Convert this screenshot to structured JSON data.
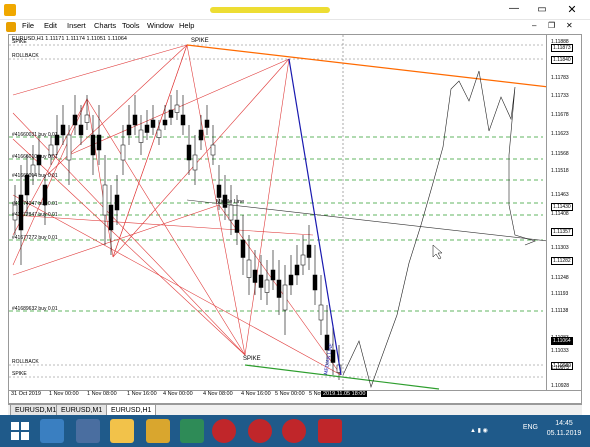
{
  "menu": [
    "File",
    "Edit",
    "Insert",
    "Charts",
    "Tools",
    "Window",
    "Help"
  ],
  "chart": {
    "header": "EURUSD,H1  1.11171 1.11174 1.11051 1.11064",
    "y_labels": [
      "1.11888",
      "1.11873",
      "1.11840",
      "1.11783",
      "1.11733",
      "1.11678",
      "1.11623",
      "1.11568",
      "1.11518",
      "1.11463",
      "1.11430",
      "1.11408",
      "1.11357",
      "1.11303",
      "1.11282",
      "1.11248",
      "1.11193",
      "1.11138",
      "1.11083",
      "1.11064",
      "1.11033",
      "1.10989",
      "1.10973",
      "1.10928"
    ],
    "x_labels": [
      "31 Oct 2019",
      "1 Nov 00:00",
      "1 Nov 08:00",
      "1 Nov 16:00",
      "4 Nov 00:00",
      "4 Nov 08:00",
      "4 Nov 16:00",
      "5 Nov 00:00",
      "5 Nov 08:00",
      "2019.11.05 18:00"
    ],
    "hlines": [
      "SPIKE",
      "ROLLBACK",
      "#41660031 buy 0.01",
      "#41666010 buy 0.01",
      "#41669014 buy 0.01",
      "#41674047 buy 0.01",
      "#41672847 buy 0.01",
      "#41677272 buy 0.01",
      "#41689632 buy 0.01",
      "ROLLBACK",
      "SPIKE"
    ],
    "annotations": [
      "SPIKE",
      "SPIKE",
      "Middle Line",
      "MEDIAN LINE"
    ]
  },
  "tabs": [
    "EURUSD,M1",
    "EURUSD,M1",
    "EURUSD,H1"
  ],
  "taskbar": {
    "lang": "ENG",
    "time": "14:45",
    "date": "05.11.2019"
  },
  "icons": [
    "app-icon",
    "minimize-icon",
    "maximize-icon",
    "close-icon",
    "windows-start-icon",
    "explorer-icon",
    "folder-icon",
    "tools-icon",
    "app-icon"
  ],
  "colors": {
    "accent_red": "#e03c3c",
    "upper_channel": "#ff6a00",
    "lower_channel": "#2e9e2e",
    "median": "#1a1ab0",
    "taskbar": "#1f5a8a"
  }
}
